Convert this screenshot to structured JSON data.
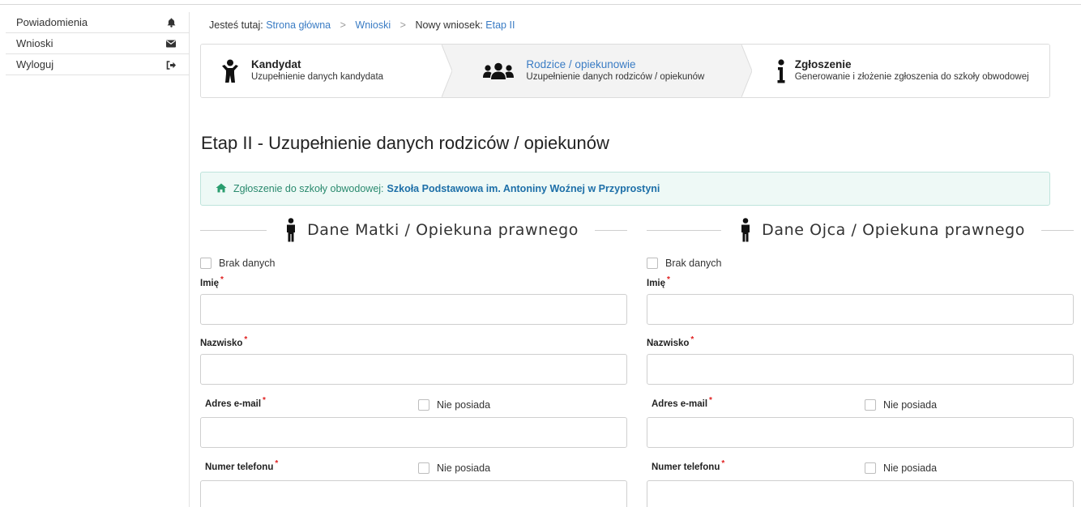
{
  "sidebar": {
    "items": [
      {
        "label": "Powiadomienia",
        "icon": "bell-icon"
      },
      {
        "label": "Wnioski",
        "icon": "envelope-icon"
      },
      {
        "label": "Wyloguj",
        "icon": "sign-out-icon"
      }
    ]
  },
  "breadcrumb": {
    "prefix": "Jesteś tutaj:",
    "home": "Strona główna",
    "applications": "Wnioski",
    "current_prefix": "Nowy wniosek:",
    "current": "Etap II"
  },
  "steps": [
    {
      "title": "Kandydat",
      "subtitle": "Uzupełnienie danych kandydata",
      "icon": "child-icon"
    },
    {
      "title": "Rodzice / opiekunowie",
      "subtitle": "Uzupełnienie danych rodziców / opiekunów",
      "icon": "users-icon"
    },
    {
      "title": "Zgłoszenie",
      "subtitle": "Generowanie i złożenie zgłoszenia do szkoły obwodowej",
      "icon": "info-icon"
    }
  ],
  "page_title": "Etap II - Uzupełnienie danych rodziców / opiekunów",
  "alert": {
    "label": "Zgłoszenie do szkoły obwodowej:",
    "school": "Szkoła Podstawowa im. Antoniny Woźnej w Przyprostyni"
  },
  "mother": {
    "heading": "Dane Matki / Opiekuna prawnego",
    "no_data": "Brak danych",
    "first_name_label": "Imię",
    "last_name_label": "Nazwisko",
    "email_label": "Adres e-mail",
    "email_none": "Nie posiada",
    "phone_label": "Numer telefonu",
    "phone_none": "Nie posiada",
    "required_mark": "*"
  },
  "father": {
    "heading": "Dane Ojca / Opiekuna prawnego",
    "no_data": "Brak danych",
    "first_name_label": "Imię",
    "last_name_label": "Nazwisko",
    "email_label": "Adres e-mail",
    "email_none": "Nie posiada",
    "phone_label": "Numer telefonu",
    "phone_none": "Nie posiada",
    "required_mark": "*"
  },
  "colors": {
    "link": "#3a7cc4",
    "alert_bg": "#eef9f6",
    "alert_text": "#2a8a6e",
    "required": "#e02020"
  }
}
